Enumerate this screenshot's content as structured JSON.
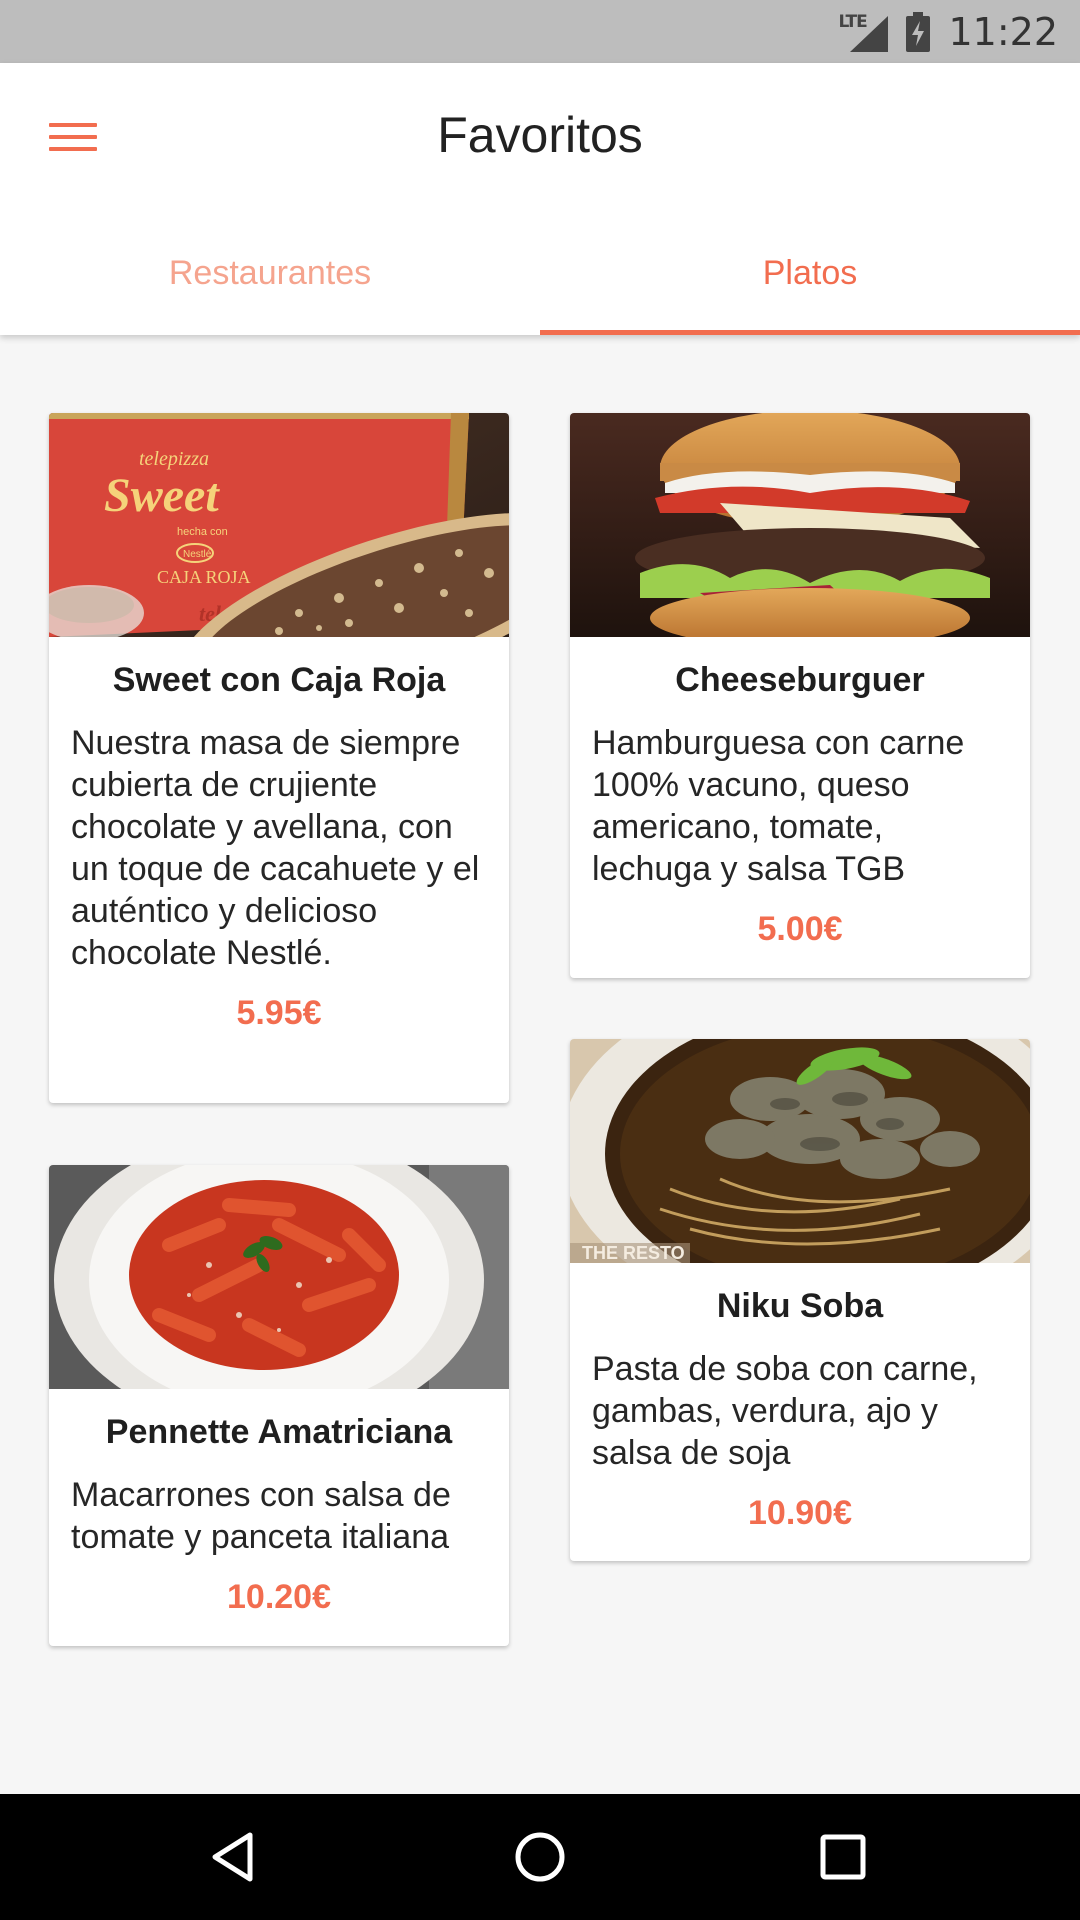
{
  "status_bar": {
    "network": "LTE",
    "time": "11:22"
  },
  "app_bar": {
    "title": "Favoritos",
    "menu_icon": "hamburger-menu-icon"
  },
  "tabs": [
    {
      "label": "Restaurantes",
      "active": false
    },
    {
      "label": "Platos",
      "active": true
    }
  ],
  "dishes": [
    {
      "name": "Sweet con Caja Roja",
      "description": "Nuestra masa de siempre cubierta de crujiente chocolate y avellana, con un toque de cacahuete y el auténtico y delicioso chocolate Nestlé.",
      "price": "5.95€",
      "image_text": {
        "brand": "telepizza",
        "title": "Sweet",
        "sub": "hecha con",
        "maker": "Nestlé",
        "box": "CAJA ROJA",
        "edge": "telepizza"
      }
    },
    {
      "name": "Cheeseburguer",
      "description": "Hamburguesa con carne 100% vacuno, queso americano, tomate, lechuga y salsa TGB",
      "price": "5.00€"
    },
    {
      "name": "Pennette Amatriciana",
      "description": "Macarrones con salsa de tomate y panceta italiana",
      "price": "10.20€"
    },
    {
      "name": "Niku Soba",
      "description": "Pasta de soba con carne, gambas, verdura, ajo y salsa de soja",
      "price": "10.90€",
      "image_text": {
        "watermark": "THE RESTO"
      }
    }
  ],
  "nav_bar": {
    "back_icon": "back-triangle-icon",
    "home_icon": "home-circle-icon",
    "recent_icon": "recent-square-icon"
  },
  "colors": {
    "accent": "#f26d4f",
    "accent_light": "#f5a48e",
    "status_bar": "#bdbdbd",
    "background": "#f6f6f6"
  }
}
